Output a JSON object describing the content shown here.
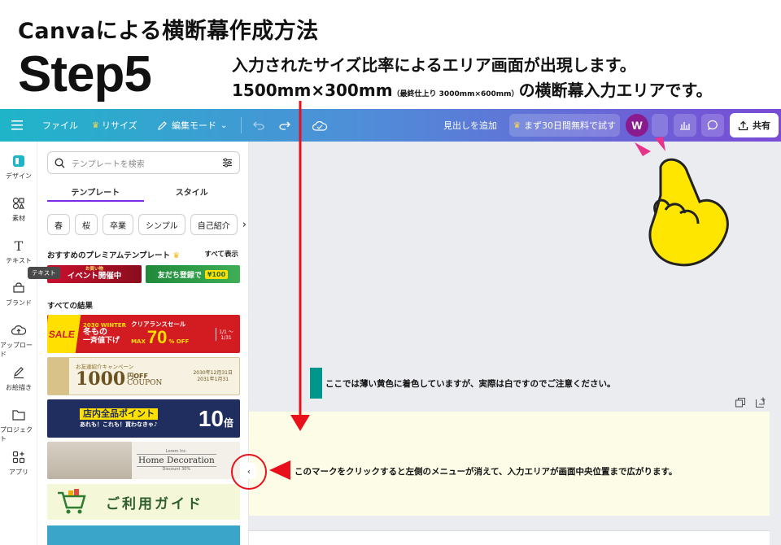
{
  "tutorial": {
    "title": "Canvaによる横断幕作成方法",
    "step": "Step5",
    "desc_line1": "入力されたサイズ比率によるエリア画面が出現します。",
    "desc_line2_main": "1500mm×300mm",
    "desc_line2_small": "（最終仕上り 3000mm×600mm）",
    "desc_line2_end": "の横断幕入力エリアです。",
    "note_color": "ここでは薄い黄色に着色していますが、実際は白ですのでご注意ください。",
    "note_collapse": "このマークをクリックすると左側のメニューが消えて、入力エリアが画面中央位置まで広がります。"
  },
  "toolbar": {
    "file": "ファイル",
    "resize": "リサイズ",
    "edit_mode": "編集モード",
    "add_heading": "見出しを追加",
    "trial": "まず30日間無料で試す",
    "avatar_initial": "W",
    "share": "共有"
  },
  "rail": {
    "design": "デザイン",
    "elements": "素材",
    "text": "テキスト",
    "brand": "ブランド",
    "upload": "アップロード",
    "draw": "お絵描き",
    "projects": "プロジェクト",
    "apps": "アプリ"
  },
  "panel": {
    "search_placeholder": "テンプレートを検索",
    "tab_templates": "テンプレート",
    "tab_styles": "スタイル",
    "chips": [
      "春",
      "桜",
      "卒業",
      "シンプル",
      "自己紹介"
    ],
    "premium_heading": "おすすめのプレミアムテンプレート",
    "see_all": "すべて表示",
    "tooltip": "テキスト",
    "all_results": "すべての結果",
    "premium_1": "イベント開催中",
    "premium_1_sub": "お買い物",
    "premium_2": "友だち登録で",
    "premium_2_price": "¥100",
    "t1_badge": "SALE",
    "t1_year": "2030 WINTER",
    "t1_title": "クリアランスセール",
    "t1_line1": "冬もの",
    "t1_line2": "一斉値下げ",
    "t1_max": "MAX",
    "t1_pct": "70",
    "t1_off": "% OFF",
    "t1_date": "1/1 ～ 1/31",
    "t2_sub": "お友達紹介キャンペーン",
    "t2_big": "1000",
    "t2_yen": "円OFF",
    "t2_coupon": "COUPON",
    "t2_date1": "2030年12月31日",
    "t2_date2": "2031年1月31",
    "t3_title": "店内全品ポイント",
    "t3_sub": "あれも！これも！買わなきゃ♪",
    "t3_num": "10",
    "t3_unit": "倍",
    "t4_title": "Home Decoration",
    "t4_small": "Lorem Inc.",
    "t4_discount": "Discount 30%",
    "t5_title": "ご利用ガイド"
  },
  "colors": {
    "accent": "#7d2ae8",
    "red": "#e8101a",
    "teal": "#00968c",
    "art_bg": "#fdfde7"
  }
}
